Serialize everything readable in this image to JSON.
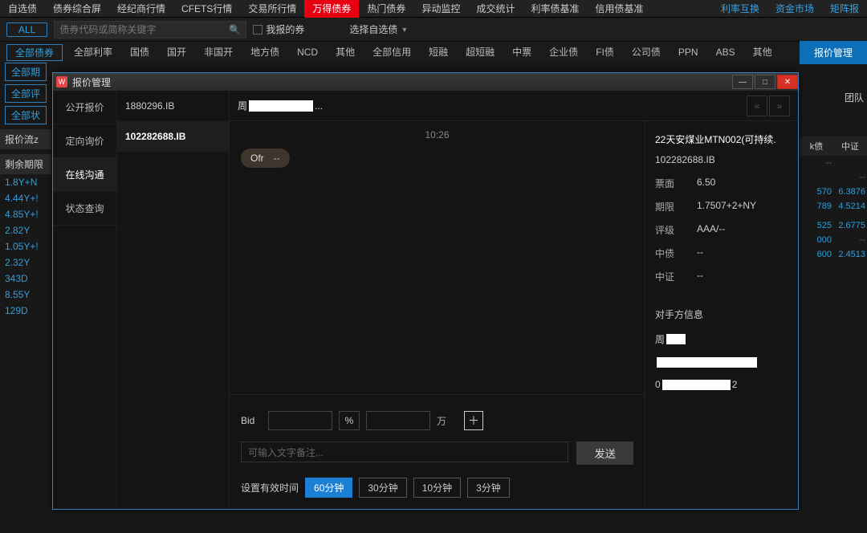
{
  "topnav": {
    "tabs": [
      "自选债",
      "债券综合屏",
      "经纪商行情",
      "CFETS行情",
      "交易所行情",
      "万得债券",
      "热门债券",
      "异动监控",
      "成交统计",
      "利率债基准",
      "信用债基准"
    ],
    "active_index": 5,
    "right_tabs": [
      "利率互换",
      "资金市场",
      "矩阵报"
    ]
  },
  "subbar": {
    "all": "ALL",
    "search_placeholder": "债券代码或简称关键字",
    "my_quote": "我报的券",
    "select_optional": "选择自选债"
  },
  "categories": {
    "lead": "全部债券",
    "items": [
      "全部利率",
      "国债",
      "国开",
      "非国开",
      "地方债",
      "NCD",
      "其他",
      "全部信用",
      "短融",
      "超短融",
      "中票",
      "企业债",
      "FI债",
      "公司债",
      "PPN",
      "ABS",
      "其他"
    ],
    "mgmt_btn": "报价管理"
  },
  "left_filters": [
    "全部期",
    "全部评",
    "全部状"
  ],
  "left_headers": {
    "flow": "报价流z",
    "remain": "剩余期限"
  },
  "left_values": [
    "1.8Y+N",
    "4.44Y+!",
    "4.85Y+!",
    "2.82Y",
    "1.05Y+!",
    "2.32Y",
    "343D",
    "8.55Y",
    "129D"
  ],
  "right_table": {
    "headers": [
      "k债",
      "中证"
    ],
    "rows": [
      {
        "a": "--",
        "b": ""
      },
      {
        "a": "",
        "b": "--"
      },
      {
        "a": "570",
        "b": "6.3876"
      },
      {
        "a": "789",
        "b": "4.5214"
      },
      {
        "a": "",
        "b": ""
      },
      {
        "a": "525",
        "b": "2.6775"
      },
      {
        "a": "000",
        "b": "--"
      },
      {
        "a": "600",
        "b": "2.4513"
      }
    ]
  },
  "team_hdr": "团队",
  "dialog": {
    "icon": "W",
    "title": "报价管理",
    "nav": [
      "公开报价",
      "定向询价",
      "在线沟通",
      "状态查询"
    ],
    "nav_active": 2,
    "list": [
      "1880296.IB",
      "102282688.IB"
    ],
    "list_active": 1,
    "header_name_prefix": "周",
    "header_name_suffix": "...",
    "chat": {
      "time": "10:26",
      "bubble_label": "Ofr",
      "bubble_value": "--"
    },
    "input": {
      "bid_label": "Bid",
      "pct": "%",
      "unit": "万",
      "remark_placeholder": "可输入文字备注...",
      "send": "发送",
      "duration_label": "设置有效时间",
      "durations": [
        "60分钟",
        "30分钟",
        "10分钟",
        "3分钟"
      ],
      "duration_active": 0
    },
    "detail": {
      "bond_name": "22天安煤业MTN002(可持续.",
      "code": "102282688.IB",
      "rows": [
        {
          "k": "票面",
          "v": "6.50"
        },
        {
          "k": "期限",
          "v": "1.7507+2+NY"
        },
        {
          "k": "评级",
          "v": "AAA/--"
        },
        {
          "k": "中债",
          "v": "--"
        },
        {
          "k": "中证",
          "v": "--"
        }
      ],
      "counterparty_title": "对手方信息",
      "cp_name_prefix": "周",
      "cp_row2_prefix": "",
      "cp_row3_prefix": "0",
      "cp_row3_suffix": "2"
    }
  }
}
